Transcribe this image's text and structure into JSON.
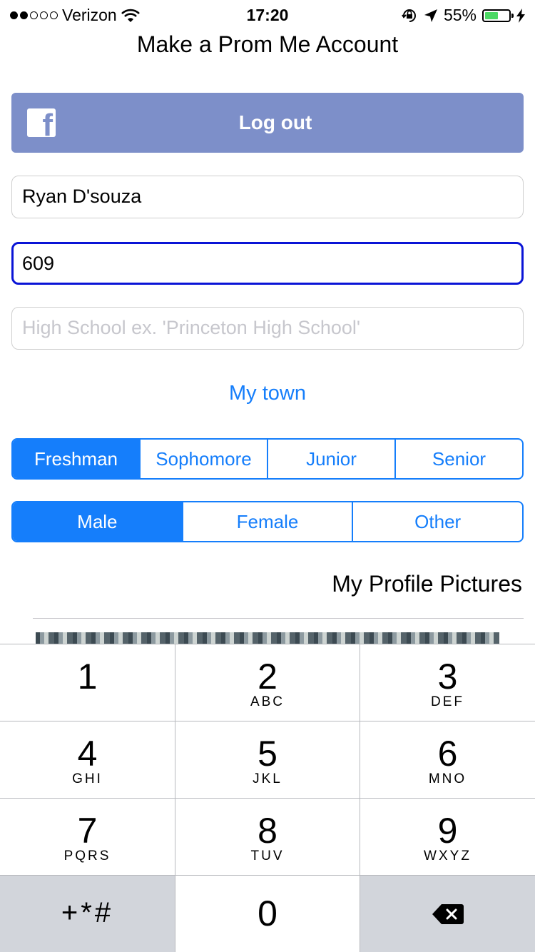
{
  "status_bar": {
    "carrier": "Verizon",
    "time": "17:20",
    "battery": "55%",
    "battery_level": 0.55,
    "signal_dots_filled": 2,
    "signal_dots_total": 5
  },
  "header": {
    "title": "Make a Prom Me Account"
  },
  "facebook": {
    "logo_letter": "f",
    "label": "Log out"
  },
  "form": {
    "name_value": "Ryan D'souza",
    "phone_value": "609",
    "school_placeholder": "High School ex. 'Princeton High School'"
  },
  "town_link": "My town",
  "grade_segment": {
    "options": [
      "Freshman",
      "Sophomore",
      "Junior",
      "Senior"
    ],
    "selected": "Freshman"
  },
  "gender_segment": {
    "options": [
      "Male",
      "Female",
      "Other"
    ],
    "selected": "Male"
  },
  "profile_pictures_label": "My Profile Pictures",
  "keypad": {
    "keys": [
      {
        "num": "1",
        "letters": ""
      },
      {
        "num": "2",
        "letters": "ABC"
      },
      {
        "num": "3",
        "letters": "DEF"
      },
      {
        "num": "4",
        "letters": "GHI"
      },
      {
        "num": "5",
        "letters": "JKL"
      },
      {
        "num": "6",
        "letters": "MNO"
      },
      {
        "num": "7",
        "letters": "PQRS"
      },
      {
        "num": "8",
        "letters": "TUV"
      },
      {
        "num": "9",
        "letters": "WXYZ"
      }
    ],
    "symbols": "+*#",
    "zero": "0"
  },
  "colors": {
    "accent": "#157efb",
    "facebook": "#7d8fc9",
    "focus_border": "#0a14d6",
    "battery_green": "#4cd964"
  }
}
